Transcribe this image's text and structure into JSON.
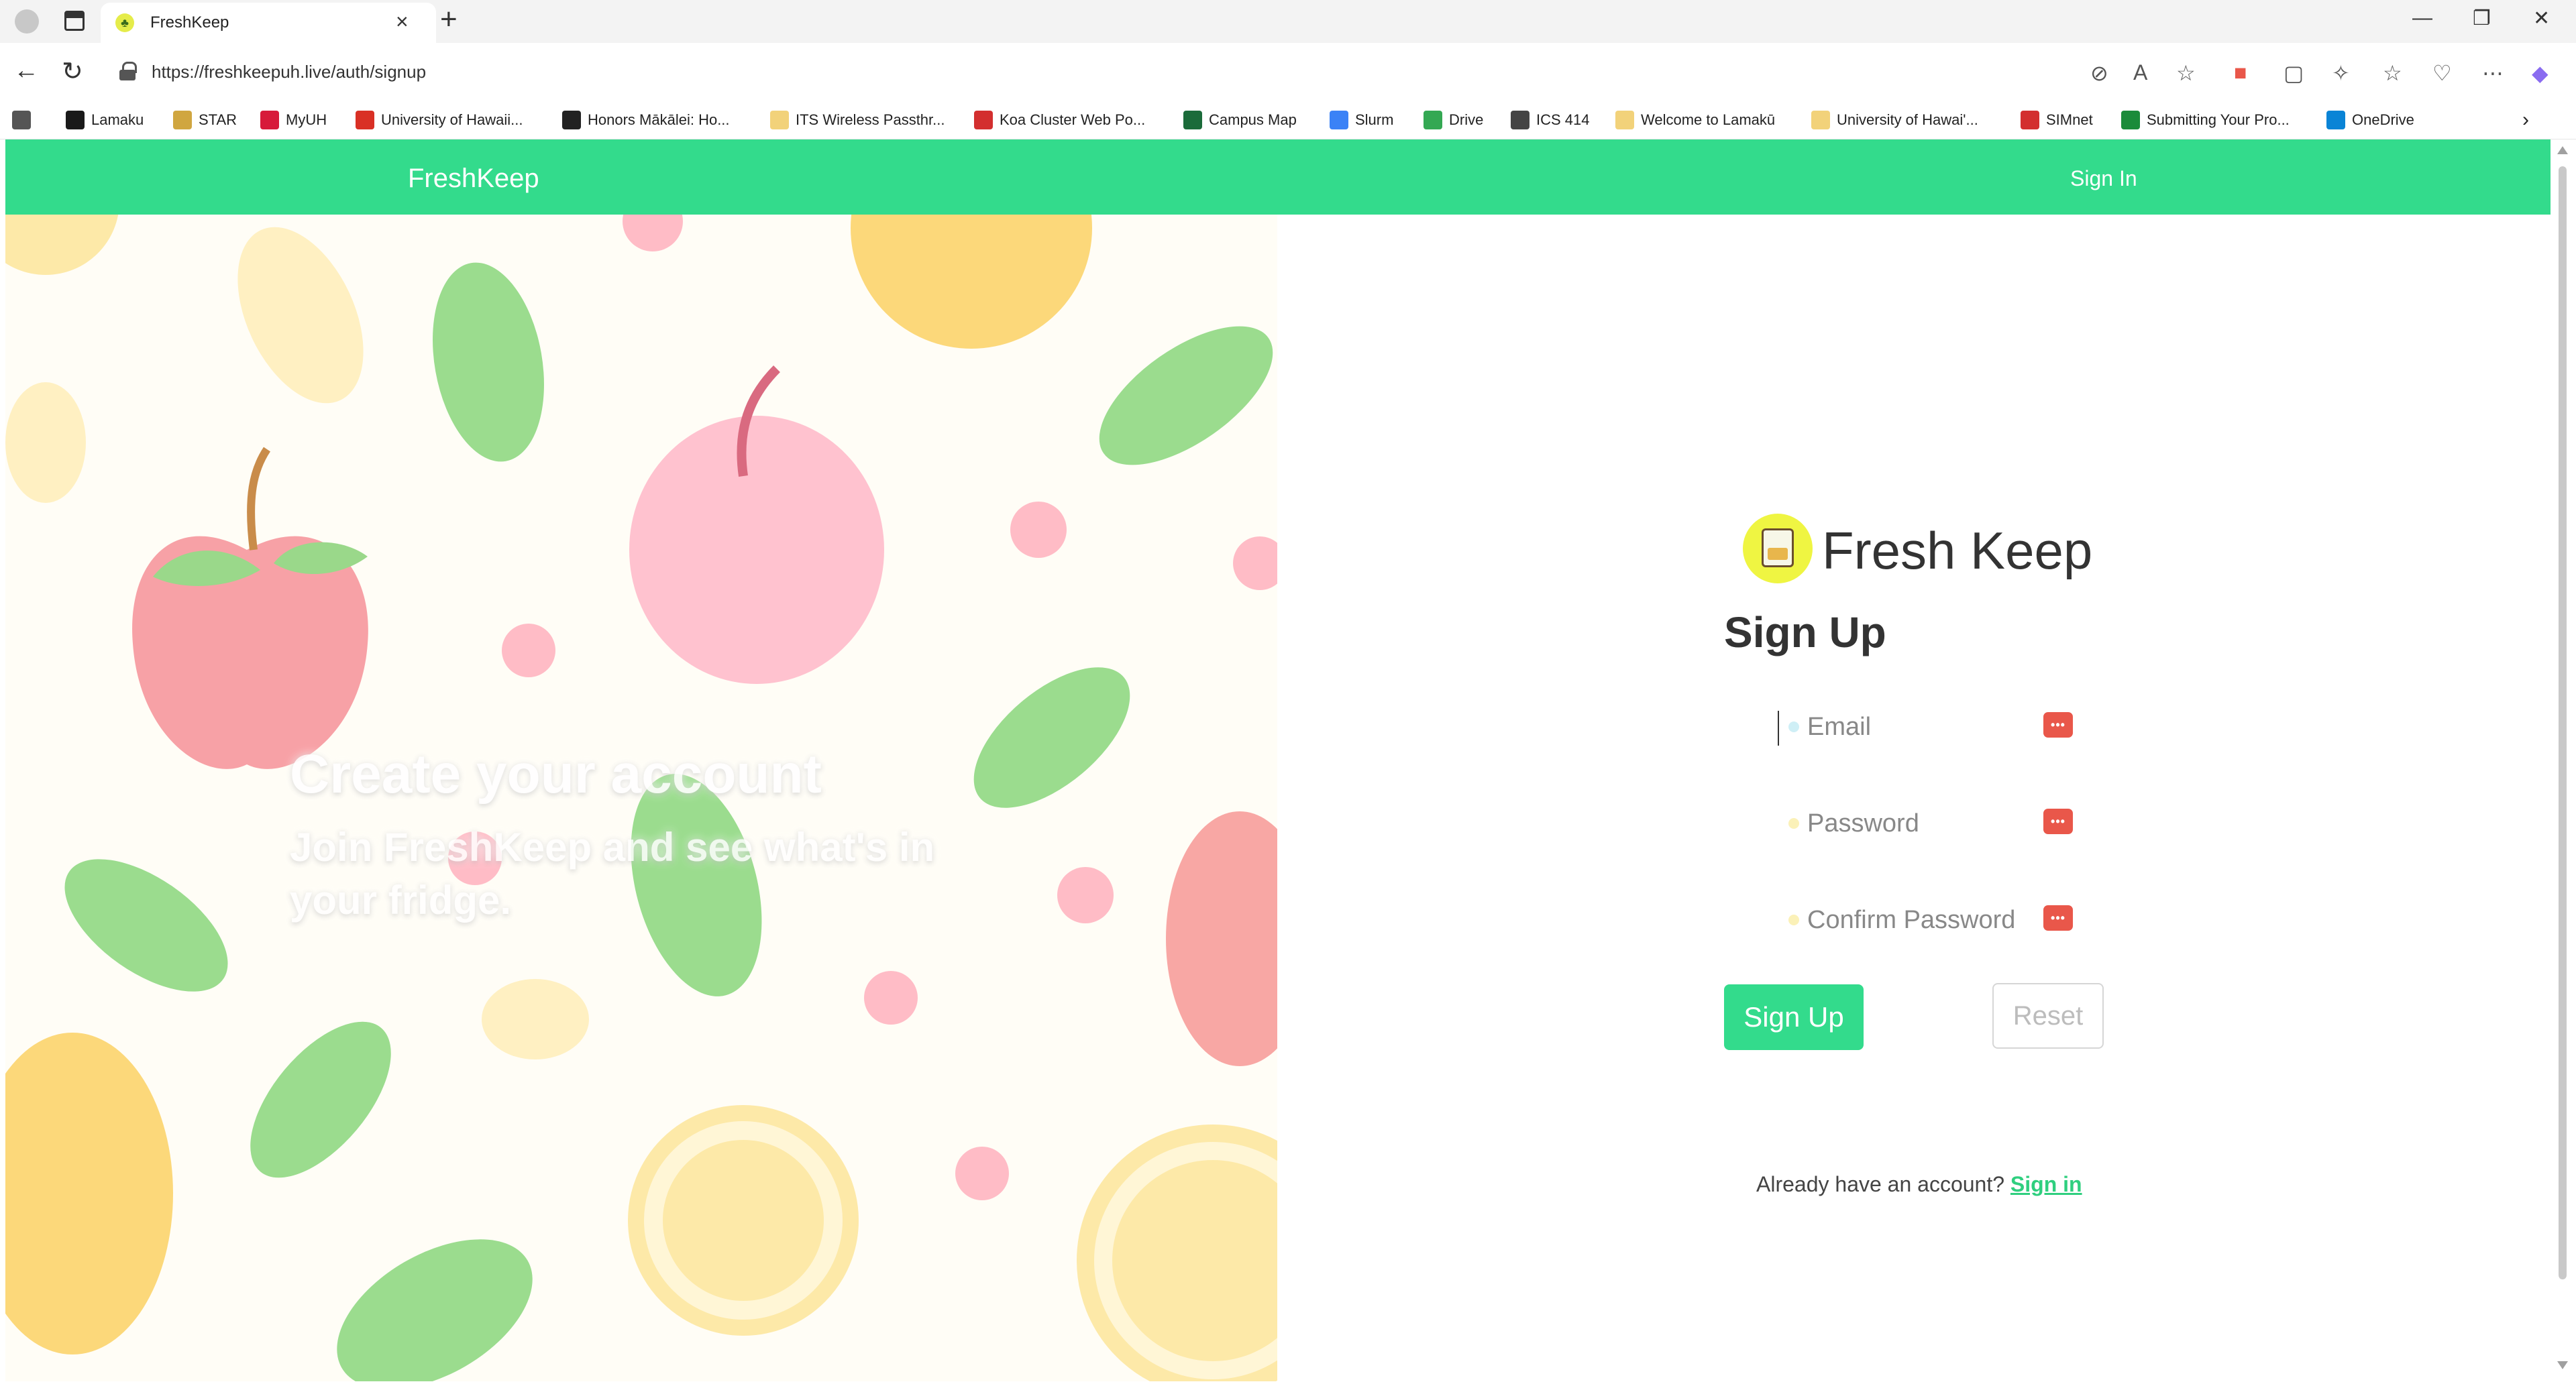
{
  "browser": {
    "tab_title": "FreshKeep",
    "tab_close": "×",
    "new_tab": "+",
    "url": "https://freshkeepuh.live/auth/signup",
    "window_controls": {
      "minimize": "—",
      "restore": "❐",
      "close": "✕"
    },
    "bookmarks": [
      {
        "label": "",
        "icon": "toggle-icon",
        "color": "#555555"
      },
      {
        "label": "Lamaku",
        "icon": "d2l-icon",
        "color": "#1a1a1a"
      },
      {
        "label": "STAR",
        "icon": "star-icon",
        "color": "#d0a640"
      },
      {
        "label": "MyUH",
        "icon": "myuh-icon",
        "color": "#d71a3a"
      },
      {
        "label": "University of Hawaii...",
        "icon": "gmail-icon",
        "color": "#d93025"
      },
      {
        "label": "Honors Mākālei: Ho...",
        "icon": "quill-icon",
        "color": "#222222"
      },
      {
        "label": "ITS Wireless Passthr...",
        "icon": "folder-uh-icon",
        "color": "#f2d27a"
      },
      {
        "label": "Koa Cluster Web Po...",
        "icon": "koa-icon",
        "color": "#d32f2f"
      },
      {
        "label": "Campus Map",
        "icon": "uh-icon",
        "color": "#1b6b3a"
      },
      {
        "label": "Slurm",
        "icon": "slurm-icon",
        "color": "#3b82f6"
      },
      {
        "label": "Drive",
        "icon": "drive-icon",
        "color": "#34a853"
      },
      {
        "label": "ICS 414",
        "icon": "folder-icon",
        "color": "#444444"
      },
      {
        "label": "Welcome to Lamakū",
        "icon": "uh-folder-icon",
        "color": "#f2d27a"
      },
      {
        "label": "University of Hawai'...",
        "icon": "uh-folder-icon",
        "color": "#f2d27a"
      },
      {
        "label": "SIMnet",
        "icon": "simnet-icon",
        "color": "#d32f2f"
      },
      {
        "label": "Submitting Your Pro...",
        "icon": "submit-icon",
        "color": "#1b8b3a"
      },
      {
        "label": "OneDrive",
        "icon": "onedrive-icon",
        "color": "#0a84d6"
      }
    ],
    "more_bookmarks": "›"
  },
  "navbar": {
    "brand": "FreshKeep",
    "signin_label": "Sign In",
    "color": "#33db8c"
  },
  "hero": {
    "title": "Create your account",
    "subtitle": "Join FreshKeep and see what's in your fridge."
  },
  "signup": {
    "brand_name": "Fresh Keep",
    "heading": "Sign Up",
    "email_placeholder": "Email",
    "password_placeholder": "Password",
    "confirm_password_placeholder": "Confirm Password",
    "submit_label": "Sign Up",
    "reset_label": "Reset",
    "signin_prompt": "Already have an account?",
    "signin_link": "Sign in",
    "accent_color": "#33db8c",
    "password_manager_key": "•••"
  }
}
